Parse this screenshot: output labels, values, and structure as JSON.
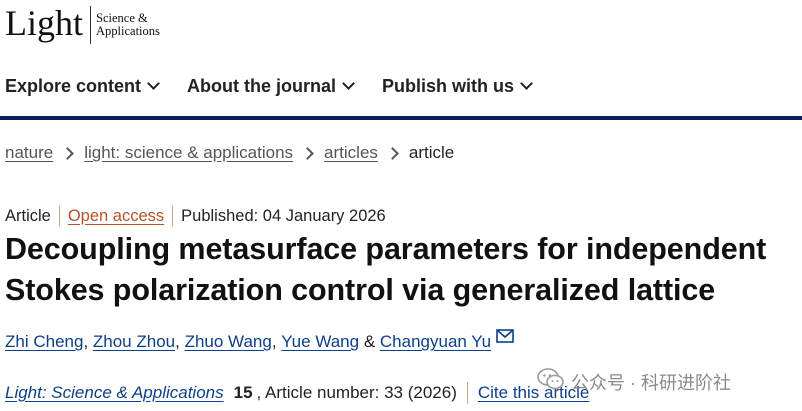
{
  "logo": {
    "main": "Light",
    "sub_line1": "Science &",
    "sub_line2": "Applications"
  },
  "nav": [
    {
      "label": "Explore content"
    },
    {
      "label": "About the journal"
    },
    {
      "label": "Publish with us"
    }
  ],
  "breadcrumb": [
    {
      "label": "nature"
    },
    {
      "label": "light: science & applications"
    },
    {
      "label": "articles"
    }
  ],
  "breadcrumb_current": "article",
  "meta": {
    "type": "Article",
    "access": "Open access",
    "published": "Published: 04 January 2026"
  },
  "title": "Decoupling metasurface parameters for independent Stokes polarization control via generalized lattice",
  "authors": [
    {
      "name": "Zhi Cheng",
      "after": ", "
    },
    {
      "name": "Zhou Zhou",
      "after": ", "
    },
    {
      "name": "Zhuo Wang",
      "after": ", "
    },
    {
      "name": "Yue Wang",
      "after": " & "
    },
    {
      "name": "Changyuan Yu",
      "after": ""
    }
  ],
  "citation": {
    "journal": "Light: Science & Applications",
    "volume": "15",
    "article_number": ", Article number: 33 (2026)",
    "cite_link": "Cite this article"
  },
  "watermark": "公众号 · 科研进阶社",
  "colors": {
    "nav_rule": "#0f1e5a",
    "link": "#0c3f8a",
    "open_access": "#b4532a"
  }
}
